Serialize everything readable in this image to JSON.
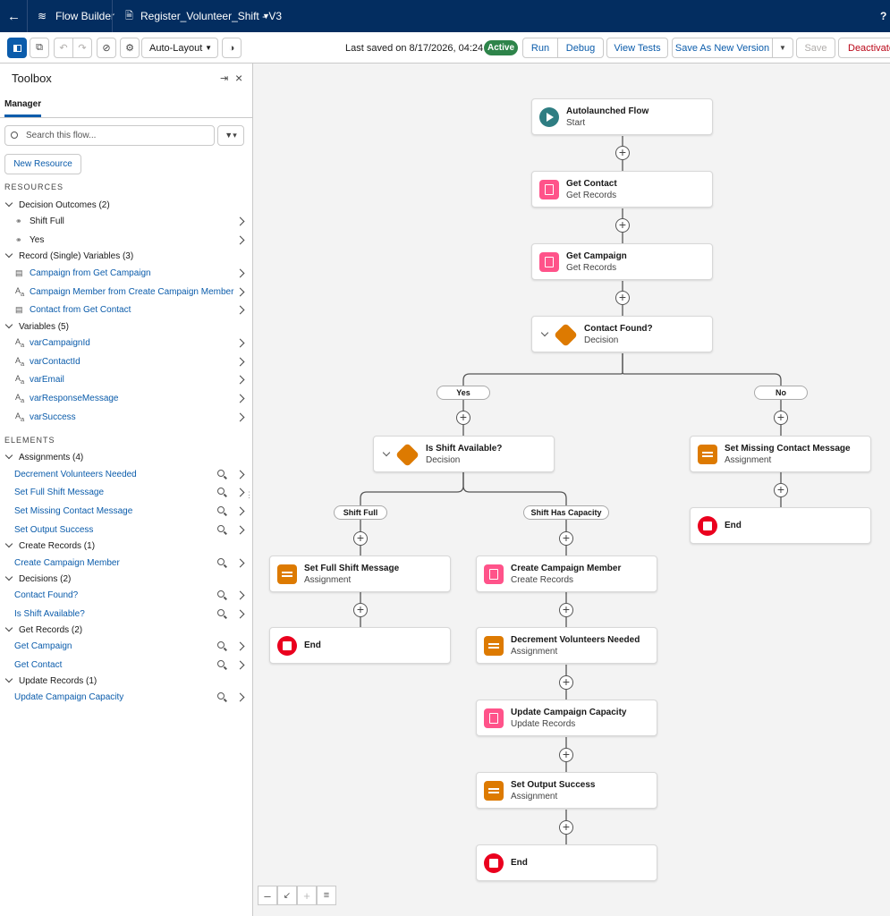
{
  "app": {
    "title": "Flow Builder",
    "flow_name": "Register_Volunteer_Shift - V3",
    "help": "?"
  },
  "toolbar": {
    "layout": "Auto-Layout",
    "last_saved": "Last saved on 8/17/2026, 04:24 PM",
    "status": "Active",
    "run": "Run",
    "debug": "Debug",
    "view_tests": "View Tests",
    "save_as_new": "Save As New Version",
    "save": "Save",
    "deactivate": "Deactivate"
  },
  "toolbox": {
    "title": "Toolbox",
    "tab": "Manager",
    "search_placeholder": "Search this flow...",
    "new_resource": "New Resource",
    "resources_header": "RESOURCES",
    "elements_header": "ELEMENTS",
    "resources": [
      {
        "group": "Decision Outcomes (2)",
        "items": [
          "Shift Full",
          "Yes"
        ]
      },
      {
        "group": "Record (Single) Variables (3)",
        "items": [
          "Campaign from Get Campaign",
          "Campaign Member from Create Campaign Member",
          "Contact from Get Contact"
        ]
      },
      {
        "group": "Variables (5)",
        "items": [
          "varCampaignId",
          "varContactId",
          "varEmail",
          "varResponseMessage",
          "varSuccess"
        ]
      }
    ],
    "elements": [
      {
        "group": "Assignments (4)",
        "items": [
          "Decrement Volunteers Needed",
          "Set Full Shift Message",
          "Set Missing Contact Message",
          "Set Output Success"
        ]
      },
      {
        "group": "Create Records (1)",
        "items": [
          "Create Campaign Member"
        ]
      },
      {
        "group": "Decisions (2)",
        "items": [
          "Contact Found?",
          "Is Shift Available?"
        ]
      },
      {
        "group": "Get Records (2)",
        "items": [
          "Get Campaign",
          "Get Contact"
        ]
      },
      {
        "group": "Update Records (1)",
        "items": [
          "Update Campaign Capacity"
        ]
      }
    ]
  },
  "canvas": {
    "start": {
      "title": "Autolaunched Flow",
      "sub": "Start"
    },
    "get_contact": {
      "title": "Get Contact",
      "sub": "Get Records"
    },
    "get_campaign": {
      "title": "Get Campaign",
      "sub": "Get Records"
    },
    "contact_found": {
      "title": "Contact Found?",
      "sub": "Decision"
    },
    "yes": "Yes",
    "no": "No",
    "shift_avail": {
      "title": "Is Shift Available?",
      "sub": "Decision"
    },
    "missing_msg": {
      "title": "Set Missing Contact Message",
      "sub": "Assignment"
    },
    "end": "End",
    "shift_full": "Shift Full",
    "shift_cap": "Shift Has Capacity",
    "full_msg": {
      "title": "Set Full Shift Message",
      "sub": "Assignment"
    },
    "create_cm": {
      "title": "Create Campaign Member",
      "sub": "Create Records"
    },
    "decrement": {
      "title": "Decrement Volunteers Needed",
      "sub": "Assignment"
    },
    "update_cap": {
      "title": "Update Campaign Capacity",
      "sub": "Update Records"
    },
    "output": {
      "title": "Set Output Success",
      "sub": "Assignment"
    }
  }
}
